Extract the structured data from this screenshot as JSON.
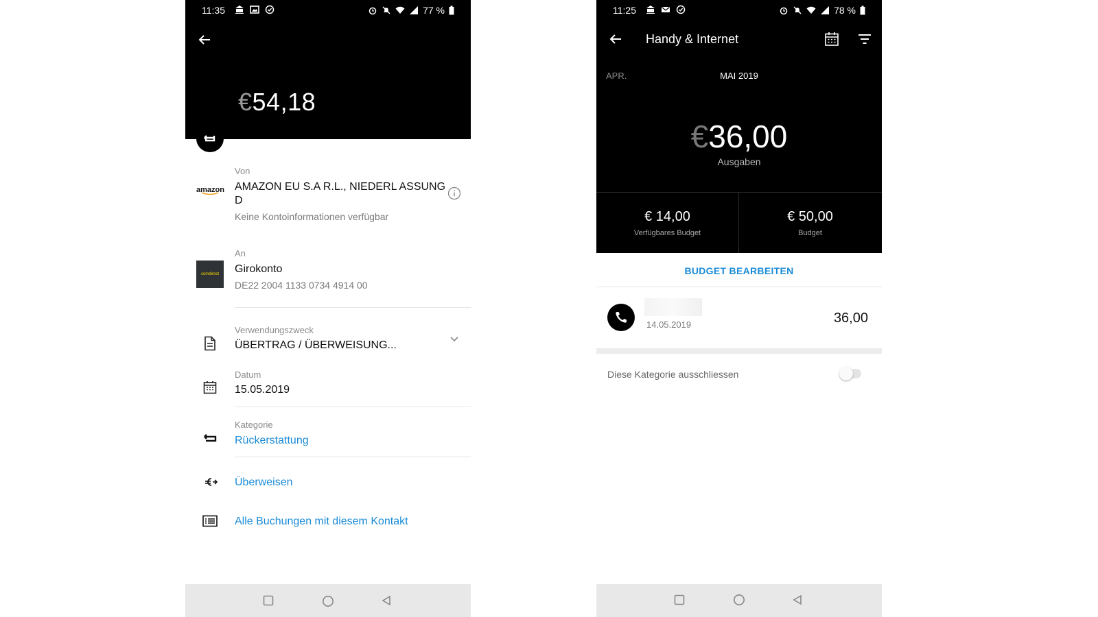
{
  "left": {
    "status": {
      "time": "11:35",
      "battery": "77 %"
    },
    "amount_currency": "€",
    "amount_value": "54,18",
    "from": {
      "label": "Von",
      "name_line1": "AMAZON EU S.A R.L., NIEDERL ASSUNG",
      "name_line2": "D",
      "sub": "Keine Kontoinformationen verfügbar",
      "logo_text": "amazon"
    },
    "to": {
      "label": "An",
      "name": "Girokonto",
      "iban": "DE22 2004 1133 0734 4914 00",
      "logo_text": "comdirect"
    },
    "purpose": {
      "label": "Verwendungszweck",
      "value": "ÜBERTRAG / ÜBERWEISUNG..."
    },
    "date": {
      "label": "Datum",
      "value": "15.05.2019"
    },
    "category": {
      "label": "Kategorie",
      "value": "Rückerstattung"
    },
    "actions": {
      "transfer": "Überweisen",
      "all_bookings": "Alle Buchungen mit diesem Kontakt"
    }
  },
  "right": {
    "status": {
      "time": "11:25",
      "battery": "78 %"
    },
    "title": "Handy & Internet",
    "prev_month": "APR.",
    "current_month": "MAI 2019",
    "spend_currency": "€",
    "spend_value": "36,00",
    "spend_label": "Ausgaben",
    "available": {
      "value": "€ 14,00",
      "label": "Verfügbares Budget"
    },
    "budget": {
      "value": "€ 50,00",
      "label": "Budget"
    },
    "edit_budget": "BUDGET BEARBEITEN",
    "transaction": {
      "date": "14.05.2019",
      "amount": "36,00"
    },
    "exclude_label": "Diese Kategorie ausschliessen",
    "exclude_enabled": false
  },
  "colors": {
    "accent": "#1a8bd6",
    "header_bg": "#000000"
  }
}
